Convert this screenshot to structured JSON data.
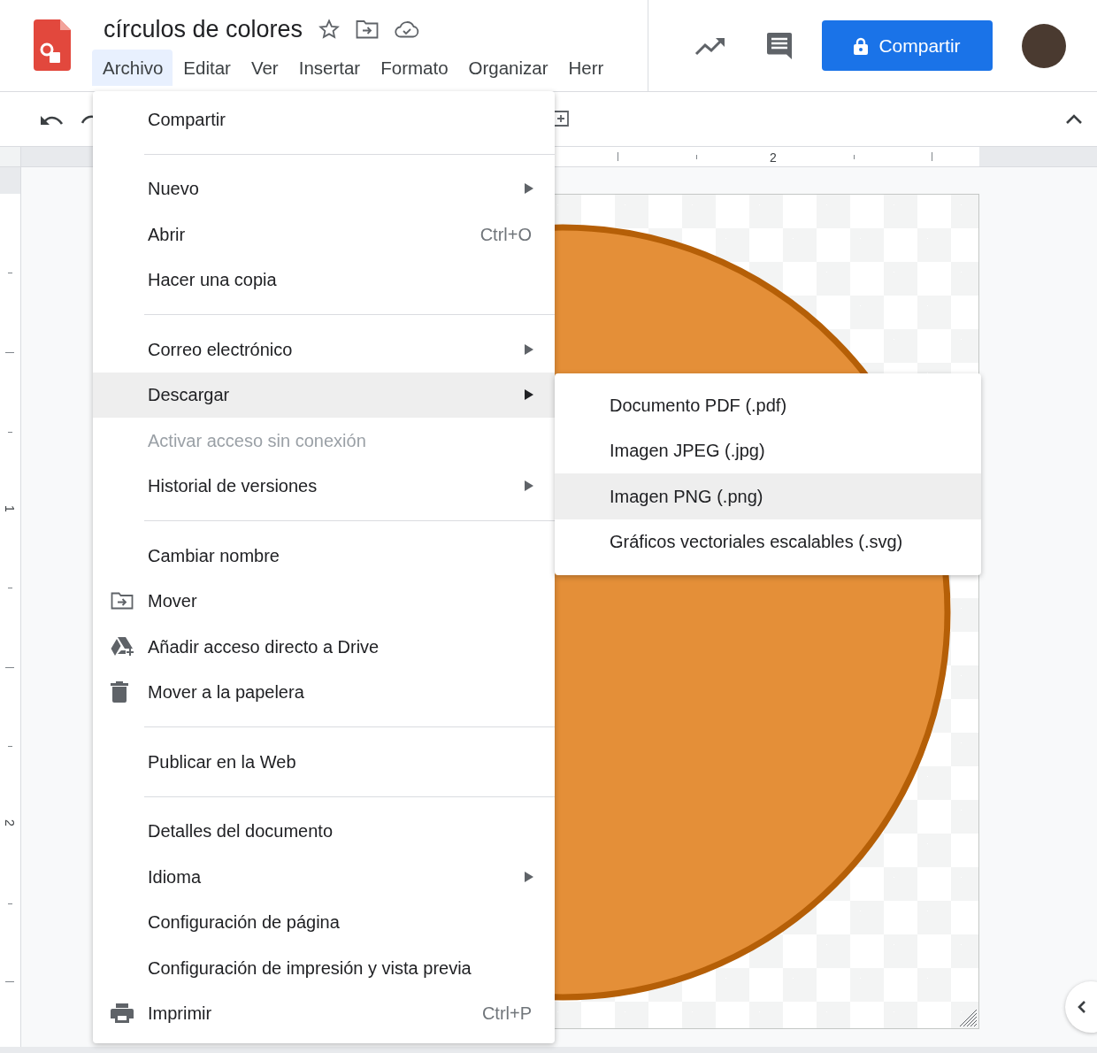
{
  "document": {
    "title": "círculos de colores"
  },
  "menu_bar": [
    {
      "label": "Archivo",
      "selected": true
    },
    {
      "label": "Editar",
      "selected": false
    },
    {
      "label": "Ver",
      "selected": false
    },
    {
      "label": "Insertar",
      "selected": false
    },
    {
      "label": "Formato",
      "selected": false
    },
    {
      "label": "Organizar",
      "selected": false
    },
    {
      "label": "Herr",
      "selected": false
    }
  ],
  "share_button": {
    "label": "Compartir"
  },
  "horizontal_ruler": {
    "label": "2"
  },
  "vertical_ruler": {
    "labels": [
      "1",
      "2"
    ]
  },
  "file_menu": [
    {
      "kind": "item",
      "label": "Compartir",
      "selected": false,
      "disabled": false,
      "submenu": false
    },
    {
      "kind": "divider"
    },
    {
      "kind": "item",
      "label": "Nuevo",
      "selected": false,
      "disabled": false,
      "submenu": true
    },
    {
      "kind": "item",
      "label": "Abrir",
      "shortcut": "Ctrl+O",
      "selected": false,
      "disabled": false,
      "submenu": false
    },
    {
      "kind": "item",
      "label": "Hacer una copia",
      "selected": false,
      "disabled": false,
      "submenu": false
    },
    {
      "kind": "divider"
    },
    {
      "kind": "item",
      "label": "Correo electrónico",
      "selected": false,
      "disabled": false,
      "submenu": true
    },
    {
      "kind": "item",
      "label": "Descargar",
      "selected": true,
      "disabled": false,
      "submenu": true
    },
    {
      "kind": "item",
      "label": "Activar acceso sin conexión",
      "selected": false,
      "disabled": true,
      "submenu": false
    },
    {
      "kind": "item",
      "label": "Historial de versiones",
      "selected": false,
      "disabled": false,
      "submenu": true
    },
    {
      "kind": "divider"
    },
    {
      "kind": "item",
      "label": "Cambiar nombre",
      "selected": false,
      "disabled": false,
      "submenu": false
    },
    {
      "kind": "item",
      "label": "Mover",
      "selected": false,
      "disabled": false,
      "submenu": false
    },
    {
      "kind": "item",
      "label": "Añadir acceso directo a Drive",
      "selected": false,
      "disabled": false,
      "submenu": false
    },
    {
      "kind": "item",
      "label": "Mover a la papelera",
      "selected": false,
      "disabled": false,
      "submenu": false
    },
    {
      "kind": "divider"
    },
    {
      "kind": "item",
      "label": "Publicar en la Web",
      "selected": false,
      "disabled": false,
      "submenu": false
    },
    {
      "kind": "divider"
    },
    {
      "kind": "item",
      "label": "Detalles del documento",
      "selected": false,
      "disabled": false,
      "submenu": false
    },
    {
      "kind": "item",
      "label": "Idioma",
      "selected": false,
      "disabled": false,
      "submenu": true
    },
    {
      "kind": "item",
      "label": "Configuración de página",
      "selected": false,
      "disabled": false,
      "submenu": false
    },
    {
      "kind": "item",
      "label": "Configuración de impresión y vista previa",
      "selected": false,
      "disabled": false,
      "submenu": false
    },
    {
      "kind": "item",
      "label": "Imprimir",
      "shortcut": "Ctrl+P",
      "selected": false,
      "disabled": false,
      "submenu": false
    }
  ],
  "download_submenu": [
    {
      "label": "Documento PDF (.pdf)",
      "selected": false
    },
    {
      "label": "Imagen JPEG (.jpg)",
      "selected": false
    },
    {
      "label": "Imagen PNG (.png)",
      "selected": true
    },
    {
      "label": "Gráficos vectoriales escalables (.svg)",
      "selected": false
    }
  ]
}
